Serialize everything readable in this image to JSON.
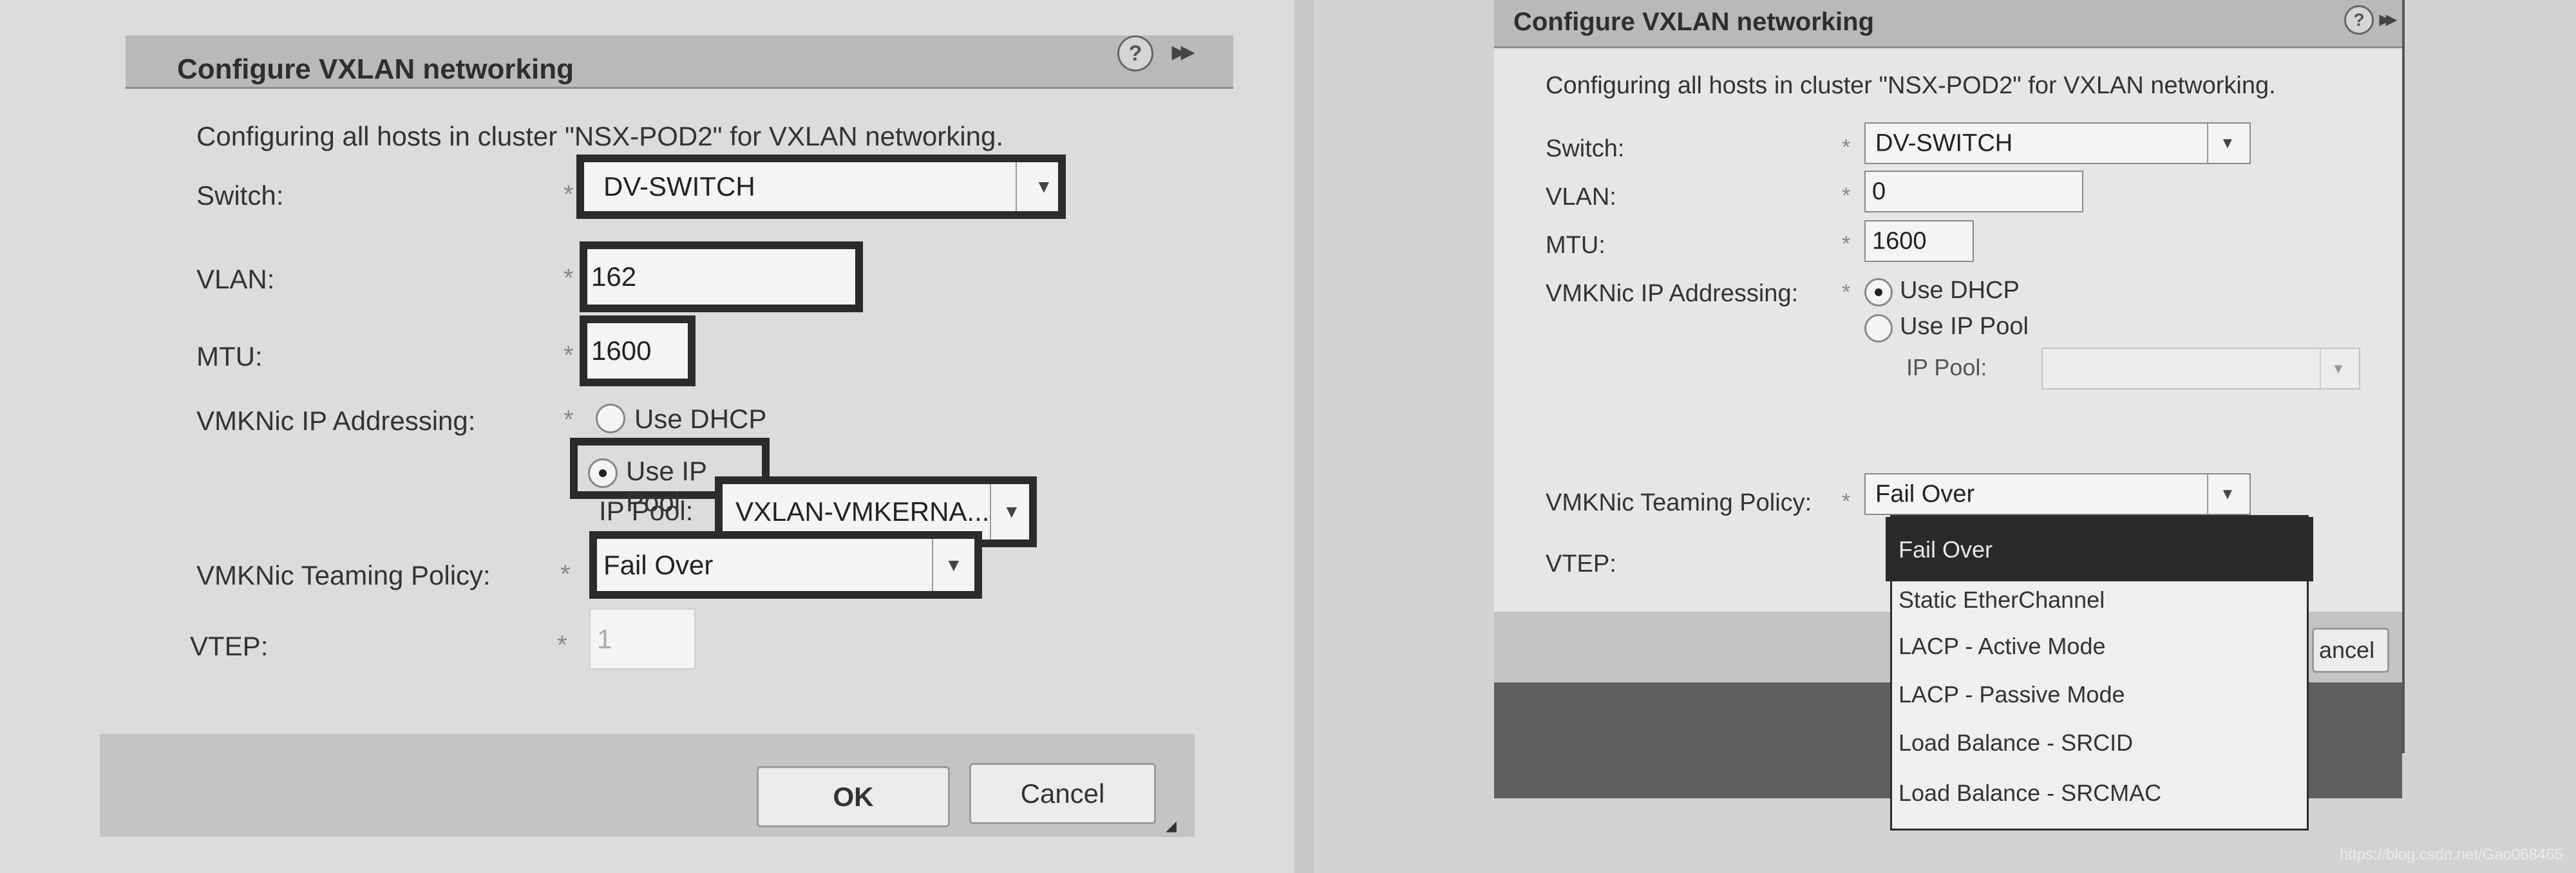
{
  "left_dialog": {
    "title": "Configure VXLAN networking",
    "help_icon": "?",
    "expand_icon": "▸▸",
    "description": "Configuring all hosts in cluster \"NSX-POD2\" for VXLAN networking.",
    "required_mark": "*",
    "switch": {
      "label": "Switch:",
      "value": "DV-SWITCH"
    },
    "vlan": {
      "label": "VLAN:",
      "value": "162"
    },
    "mtu": {
      "label": "MTU:",
      "value": "1600"
    },
    "ip_addressing": {
      "label": "VMKNic IP Addressing:",
      "options": [
        "Use DHCP",
        "Use IP Pool"
      ],
      "selected": "Use IP Pool"
    },
    "ip_pool": {
      "label": "IP Pool:",
      "value": "VXLAN-VMKERNA..."
    },
    "teaming_policy": {
      "label": "VMKNic Teaming Policy:",
      "value": "Fail Over"
    },
    "vtep": {
      "label": "VTEP:",
      "value": "1"
    },
    "buttons": {
      "ok": "OK",
      "cancel": "Cancel"
    }
  },
  "right_dialog": {
    "title": "Configure VXLAN networking",
    "help_icon": "?",
    "expand_icon": "▸▸",
    "description": "Configuring all hosts in cluster \"NSX-POD2\" for VXLAN networking.",
    "required_mark": "*",
    "switch": {
      "label": "Switch:",
      "value": "DV-SWITCH"
    },
    "vlan": {
      "label": "VLAN:",
      "value": "0"
    },
    "mtu": {
      "label": "MTU:",
      "value": "1600"
    },
    "ip_addressing": {
      "label": "VMKNic IP Addressing:",
      "options": [
        "Use DHCP",
        "Use IP Pool"
      ],
      "selected": "Use DHCP"
    },
    "ip_pool": {
      "label": "IP Pool:",
      "value": ""
    },
    "teaming_policy": {
      "label": "VMKNic Teaming Policy:",
      "value": "Fail Over",
      "dropdown_open": true,
      "options": [
        "Fail Over",
        "Static EtherChannel",
        "LACP - Active Mode",
        "LACP - Passive Mode",
        "Load Balance - SRCID",
        "Load Balance - SRCMAC"
      ],
      "highlighted": "Fail Over"
    },
    "vtep": {
      "label": "VTEP:"
    },
    "buttons": {
      "cancel_partial": "ancel"
    }
  },
  "watermark": "https://blog.csdn.net/Gao068465"
}
